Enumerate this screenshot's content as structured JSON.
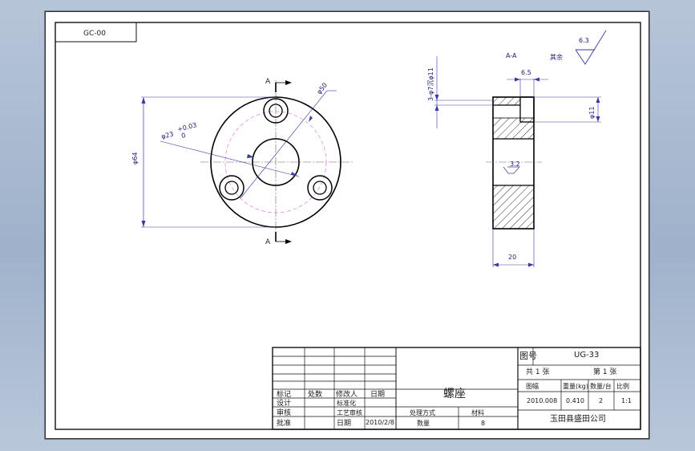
{
  "drawing_code": "GC-00",
  "views": {
    "front": {
      "section_mark": "A",
      "dim_outer": "φ64",
      "dim_bolt_circle": "φ50",
      "dim_bore": "φ23",
      "dim_bore_tol_upper": "+0.03",
      "dim_bore_tol_lower": "0"
    },
    "section": {
      "title": "A-A",
      "dim_width_top": "6.5",
      "dim_holes": "3-φ7沉φ11",
      "dim_counterbore": "φ11",
      "roughness_inner": "3.2",
      "dim_width_bottom": "20"
    },
    "roughness_note": {
      "label": "其余",
      "value": "6.3"
    }
  },
  "title_block": {
    "left_headers": [
      "标记",
      "处数",
      "修改人",
      "日期"
    ],
    "design_label": "设计",
    "standardize_label": "标准化",
    "review_label": "审核",
    "process_label": "工艺审核",
    "approve_label": "批准",
    "date_label": "日期",
    "date_value": "2010/2/8",
    "part_name": "螺座",
    "processing_label": "处理方式",
    "material_label": "材料",
    "quantity_label": "数量",
    "quantity_value": "8",
    "drawing_no_label": "图号",
    "drawing_no_value": "UG-33",
    "sheets_total": "共 1 张",
    "sheet_current": "第 1 张",
    "headers": [
      "图幅",
      "重量(kg)",
      "数量/台",
      "比例"
    ],
    "values": [
      "2010.008",
      "0.410",
      "2",
      "1:1"
    ],
    "company": "玉田县盛田公司"
  }
}
